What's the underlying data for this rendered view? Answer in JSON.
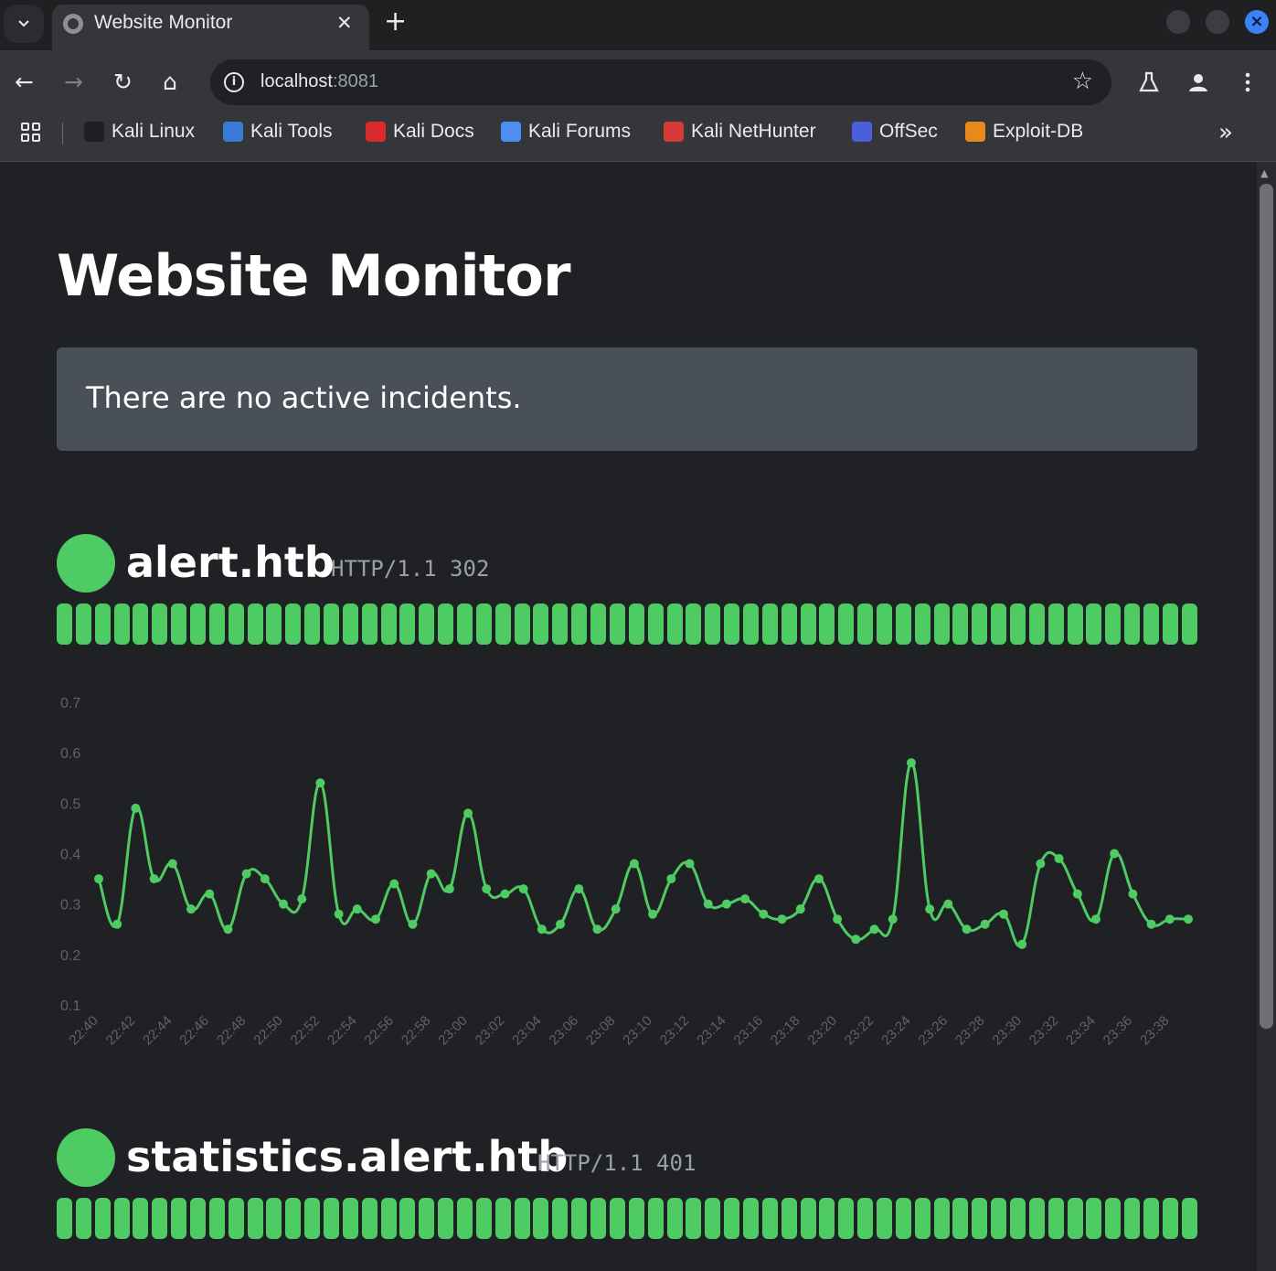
{
  "browser": {
    "tab_title": "Website Monitor",
    "tab_close": "✕",
    "new_tab": "+",
    "url_host": "localhost",
    "url_port": ":8081",
    "nav_back": "←",
    "nav_forward": "→",
    "nav_reload": "↻",
    "nav_home": "⌂",
    "bookmarks": [
      {
        "label": "Kali Linux",
        "icon": "kali-dragon-icon",
        "color": "#1f2022"
      },
      {
        "label": "Kali Tools",
        "icon": "kali-tools-icon",
        "color": "#3a7bd5"
      },
      {
        "label": "Kali Docs",
        "icon": "kali-docs-icon",
        "color": "#d92b2b"
      },
      {
        "label": "Kali Forums",
        "icon": "kali-forums-icon",
        "color": "#4c8df6"
      },
      {
        "label": "Kali NetHunter",
        "icon": "kali-nethunter-icon",
        "color": "#d83a3a"
      },
      {
        "label": "OffSec",
        "icon": "offsec-icon",
        "color": "#4a5fd9"
      },
      {
        "label": "Exploit-DB",
        "icon": "exploit-db-icon",
        "color": "#e8891e"
      }
    ],
    "bookmarks_more": "»"
  },
  "page": {
    "title": "Website Monitor",
    "incident_message": "There are no active incidents."
  },
  "colors": {
    "up": "#4ecb63",
    "axis_text": "#5f6368"
  },
  "sites": [
    {
      "name": "alert.htb",
      "status": "HTTP/1.1 302",
      "state": "up",
      "history_count": 60
    },
    {
      "name": "statistics.alert.htb",
      "status": "HTTP/1.1 401",
      "state": "up",
      "history_count": 60
    }
  ],
  "chart_data": {
    "type": "line",
    "series": [
      {
        "values": [
          0.35,
          0.26,
          0.49,
          0.35,
          0.38,
          0.29,
          0.32,
          0.25,
          0.36,
          0.35,
          0.3,
          0.31,
          0.54,
          0.28,
          0.29,
          0.27,
          0.34,
          0.26,
          0.36,
          0.33,
          0.48,
          0.33,
          0.32,
          0.33,
          0.25,
          0.26,
          0.33,
          0.25,
          0.29,
          0.38,
          0.28,
          0.35,
          0.38,
          0.3,
          0.3,
          0.31,
          0.28,
          0.27,
          0.29,
          0.35,
          0.27,
          0.23,
          0.25,
          0.27,
          0.58,
          0.29,
          0.3,
          0.25,
          0.26,
          0.28,
          0.22,
          0.38,
          0.39,
          0.32,
          0.27,
          0.4,
          0.32,
          0.26,
          0.27,
          0.27
        ]
      }
    ],
    "x_tick_labels": [
      "22:40",
      "22:42",
      "22:44",
      "22:46",
      "22:48",
      "22:50",
      "22:52",
      "22:54",
      "22:56",
      "22:58",
      "23:00",
      "23:02",
      "23:04",
      "23:06",
      "23:08",
      "23:10",
      "23:12",
      "23:14",
      "23:16",
      "23:18",
      "23:20",
      "23:22",
      "23:24",
      "23:26",
      "23:28",
      "23:30",
      "23:32",
      "23:34",
      "23:36",
      "23:38"
    ],
    "y_tick_labels": [
      "0.7",
      "0.6",
      "0.5",
      "0.4",
      "0.3",
      "0.2",
      "0.1"
    ],
    "ylim": [
      0.1,
      0.7
    ],
    "grid": false
  }
}
